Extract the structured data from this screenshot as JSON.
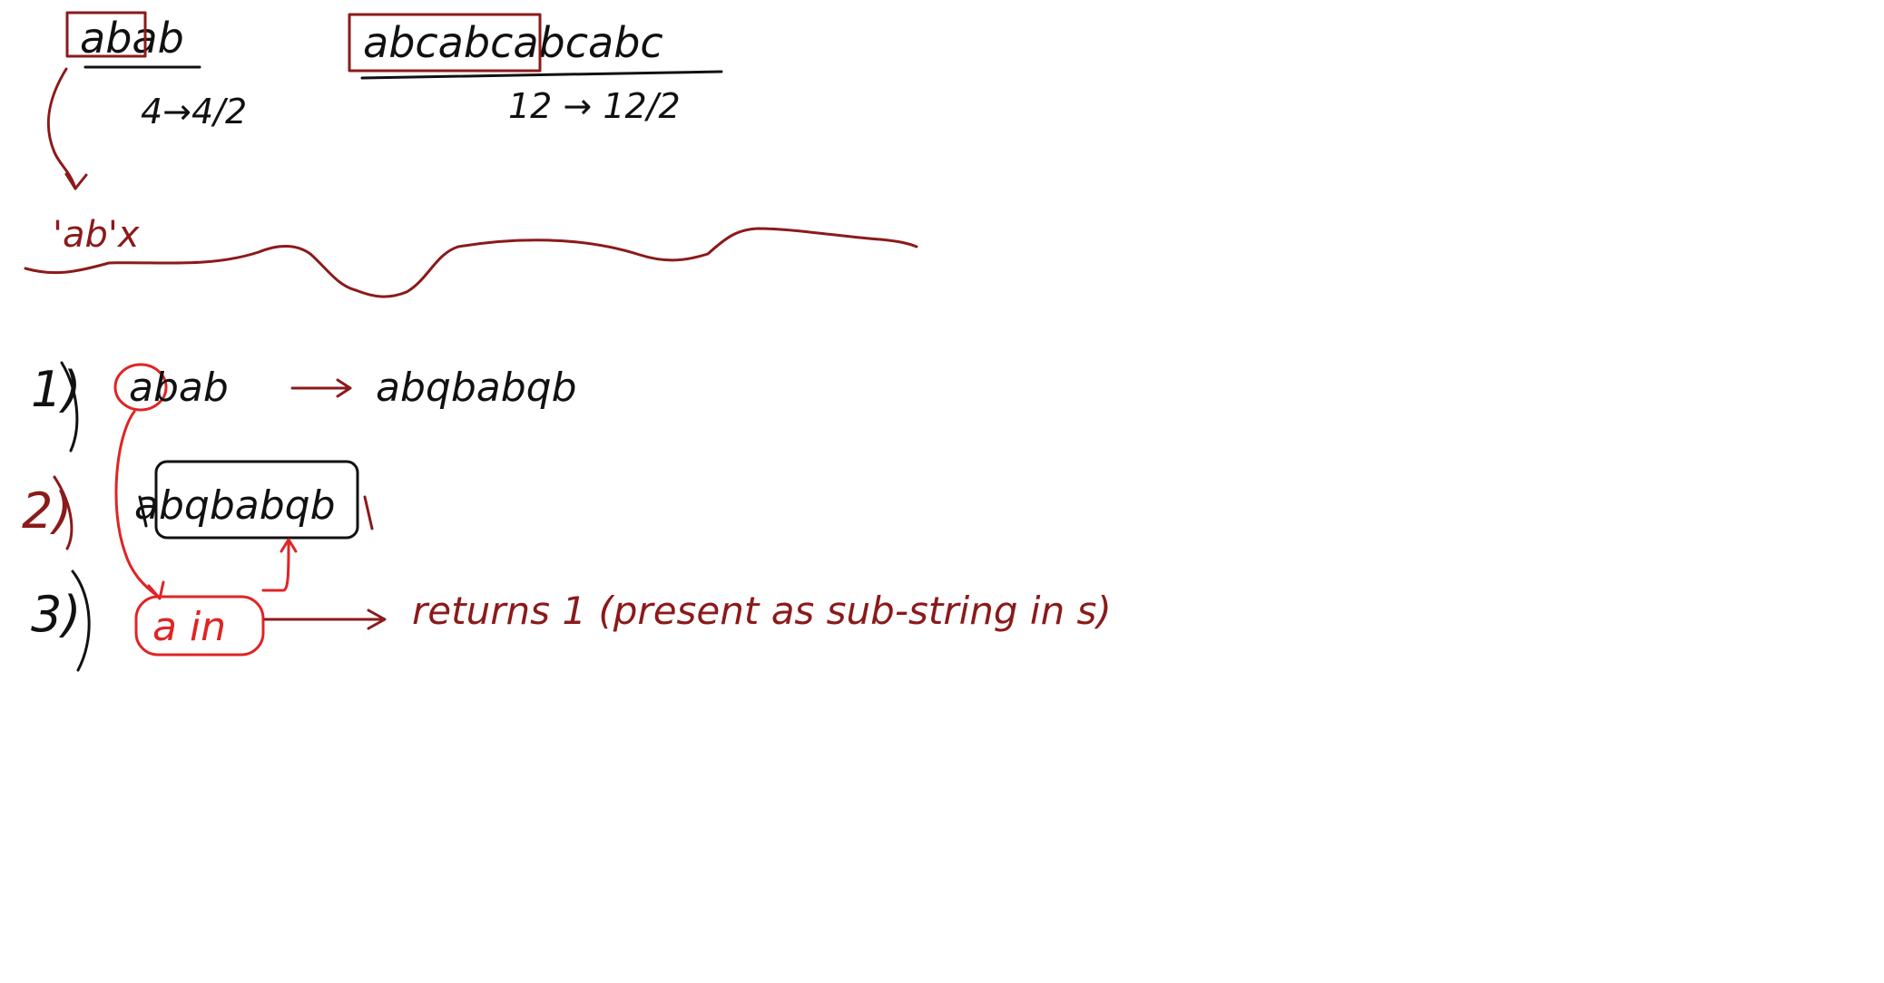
{
  "colors": {
    "background": "#ffffff",
    "black_ink": "#111111",
    "dark_red_ink": "#8b1a1a",
    "bright_red_ink": "#e02424"
  },
  "example_top_left": {
    "string": "abab",
    "length_note": "4→4/2"
  },
  "example_top_right": {
    "string": "abcabcabcabc",
    "length_note": "12 → 12/2"
  },
  "side_note": "'ab'x",
  "steps": {
    "step1": {
      "number": "1)",
      "input": "abab",
      "result": "abqbabqb"
    },
    "step2": {
      "number": "2)",
      "string": "abqbabqb"
    },
    "step3": {
      "number": "3)",
      "expression": "a in",
      "conclusion": "returns 1 (present as sub-string in s)"
    }
  }
}
